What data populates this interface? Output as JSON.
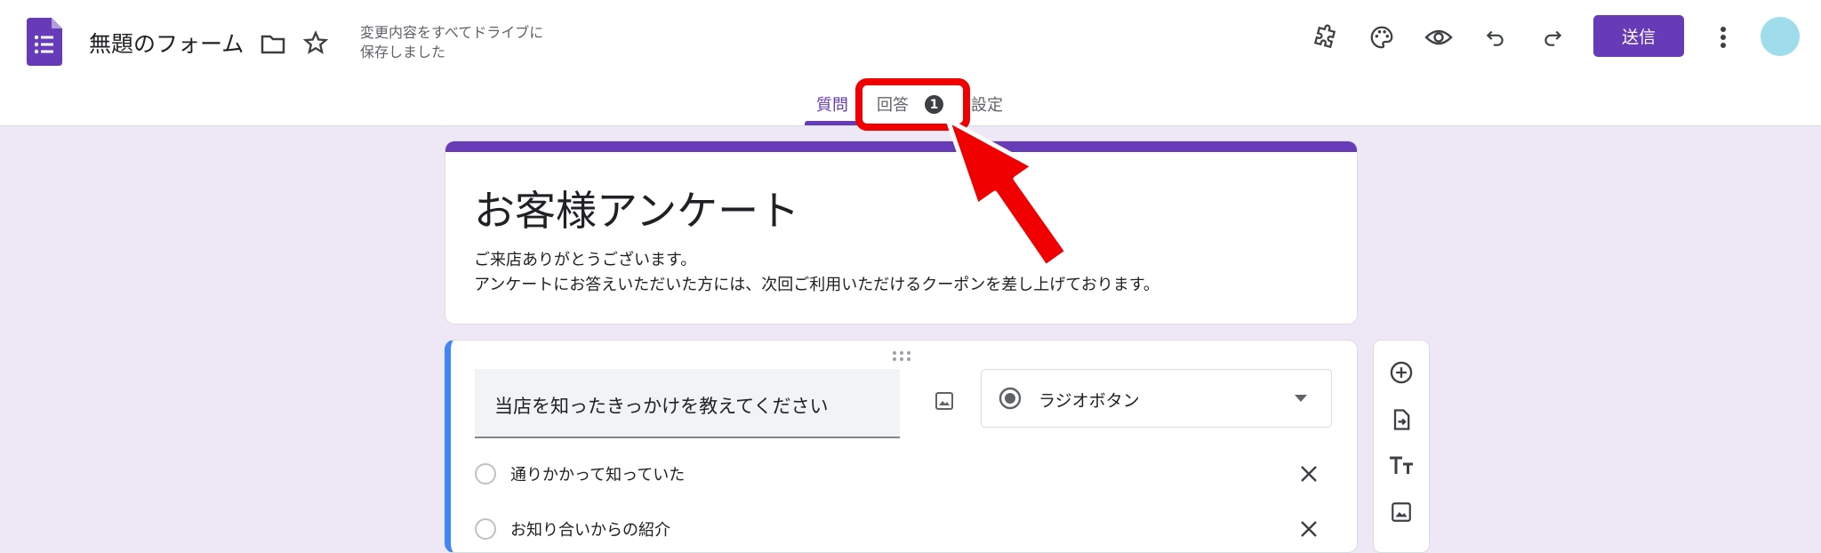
{
  "header": {
    "doc_title": "無題のフォーム",
    "save_status_line1": "変更内容をすべてドライブに",
    "save_status_line2": "保存しました",
    "send_label": "送信",
    "app_icon": "forms-icon",
    "icons": [
      "folder-icon",
      "star-icon",
      "addon-icon",
      "palette-icon",
      "preview-eye-icon",
      "undo-icon",
      "redo-icon",
      "more-vert-icon"
    ]
  },
  "tabs": {
    "questions": "質問",
    "responses": "回答",
    "responses_badge": "1",
    "settings": "設定"
  },
  "form": {
    "title": "お客様アンケート",
    "description_line1": "ご来店ありがとうございます。",
    "description_line2": "アンケートにお答えいただいた方には、次回ご利用いただけるクーポンを差し上げております。"
  },
  "question": {
    "text": "当店を知ったきっかけを教えてください",
    "type": "ラジオボタン",
    "options": [
      "通りかかって知っていた",
      "お知り合いからの紹介"
    ]
  },
  "toolbar": {
    "icons": [
      "add-question-icon",
      "import-questions-icon",
      "add-title-icon",
      "add-image-icon"
    ]
  },
  "colors": {
    "accent": "#673ab7",
    "background": "#ede7f6",
    "annotation": "#f00000",
    "question_border": "#4285f4"
  }
}
